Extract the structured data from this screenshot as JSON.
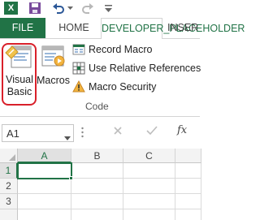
{
  "qat": {
    "app_letter": "X"
  },
  "tabs": {
    "file": "FILE",
    "home": "HOME",
    "developer": "DEVELOPER_PLACEHOLDER",
    "insert": "INSER"
  },
  "ribbon": {
    "visual_basic_line1": "Visual",
    "visual_basic_line2": "Basic",
    "macros": "Macros",
    "record_macro": "Record Macro",
    "use_relative_references": "Use Relative References",
    "macro_security": "Macro Security",
    "group_label": "Code"
  },
  "formula_bar": {
    "name_box": "A1",
    "fx": "fx"
  },
  "grid": {
    "columns": [
      "A",
      "B",
      "C"
    ],
    "rows": [
      "1",
      "2",
      "3"
    ]
  },
  "colors": {
    "accent": "#217346",
    "highlight_ring": "#d9202a"
  }
}
